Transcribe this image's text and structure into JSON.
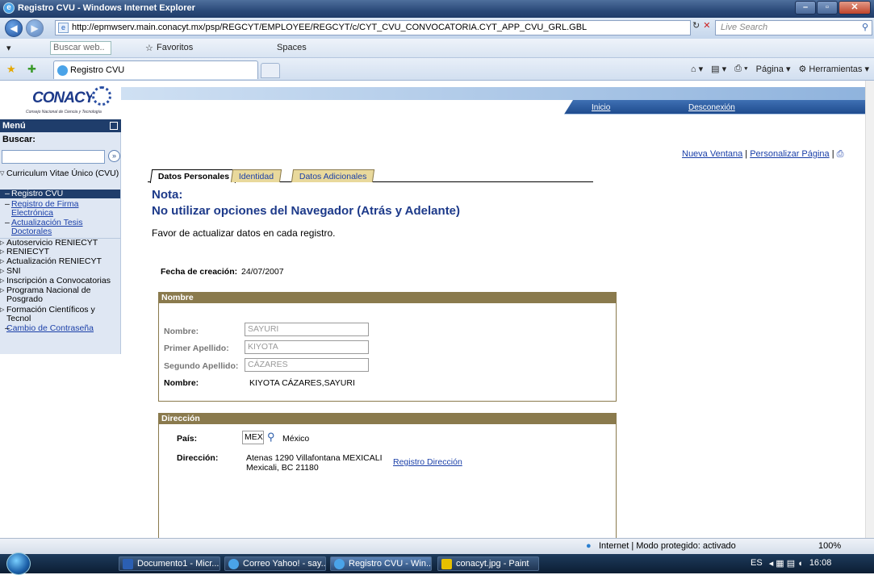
{
  "window": {
    "title": "Registro CVU - Windows Internet Explorer"
  },
  "address": {
    "url": "http://epmwserv.main.conacyt.mx/psp/REGCYT/EMPLOYEE/REGCYT/c/CYT_CVU_CONVOCATORIA.CYT_APP_CVU_GRL.GBL",
    "search_placeholder": "Live Search"
  },
  "toolbar": {
    "search_web": "Buscar web..",
    "favorites": "Favoritos",
    "spaces": "Spaces"
  },
  "tab": {
    "label": "Registro CVU"
  },
  "commands": {
    "pagina": "Página",
    "herramientas": "Herramientas"
  },
  "header": {
    "logo": "CONACYT",
    "logo_sub": "Consejo Nacional de Ciencia y Tecnología",
    "inicio": "Inicio",
    "desconexion": "Desconexión"
  },
  "menu": {
    "title": "Menú",
    "buscar": "Buscar:",
    "cvu": "Curriculum Vitae Único (CVU)",
    "registro_cvu": "Registro CVU",
    "firma": "Registro de Firma Electrónica",
    "tesis": "Actualización Tesis Doctorales",
    "autoservicio": "Autoservicio RENIECYT",
    "reniecyt": "RENIECYT",
    "act_reniecyt": "Actualización RENIECYT",
    "sni": "SNI",
    "inscripcion": "Inscripción a Convocatorias",
    "posgrado": "Programa Nacional de Posgrado",
    "formacion": "Formación Científicos y Tecnol",
    "cambio": "Cambio de Contraseña"
  },
  "toplinks": {
    "nueva": "Nueva Ventana",
    "personalizar": "Personalizar Página",
    "sep": "|"
  },
  "tabs": {
    "datos": "Datos Personales",
    "identidad": "Identidad",
    "adicionales": "Datos Adicionales"
  },
  "nota": {
    "title": "Nota:",
    "warning": "No utilizar opciones del Navegador (Atrás y Adelante)",
    "instruction": "Favor de actualizar datos en cada registro."
  },
  "fecha": {
    "label": "Fecha de creación:",
    "value": "24/07/2007"
  },
  "nombre": {
    "header": "Nombre",
    "nombre_label": "Nombre:",
    "nombre_value": "SAYURI",
    "ap1_label": "Primer Apellido:",
    "ap1_value": "KIYOTA",
    "ap2_label": "Segundo Apellido:",
    "ap2_value": "CÁZARES",
    "full_label": "Nombre:",
    "full_value": "KIYOTA CÁZARES,SAYURI"
  },
  "direccion": {
    "header": "Dirección",
    "pais_label": "País:",
    "pais_code": "MEX",
    "pais_name": "México",
    "dir_label": "Dirección:",
    "line1": "Atenas 1290 Villafontana MEXICALI",
    "line2": "Mexicali, BC 21180",
    "link": "Registro Dirección"
  },
  "status": {
    "zone": "Internet | Modo protegido: activado",
    "zoom": "100%"
  },
  "taskbar": {
    "t1": "Documento1 - Micr...",
    "t2": "Correo Yahoo! - say...",
    "t3": "Registro CVU - Win...",
    "t4": "conacyt.jpg - Paint",
    "lang": "ES",
    "clock": "16:08"
  }
}
